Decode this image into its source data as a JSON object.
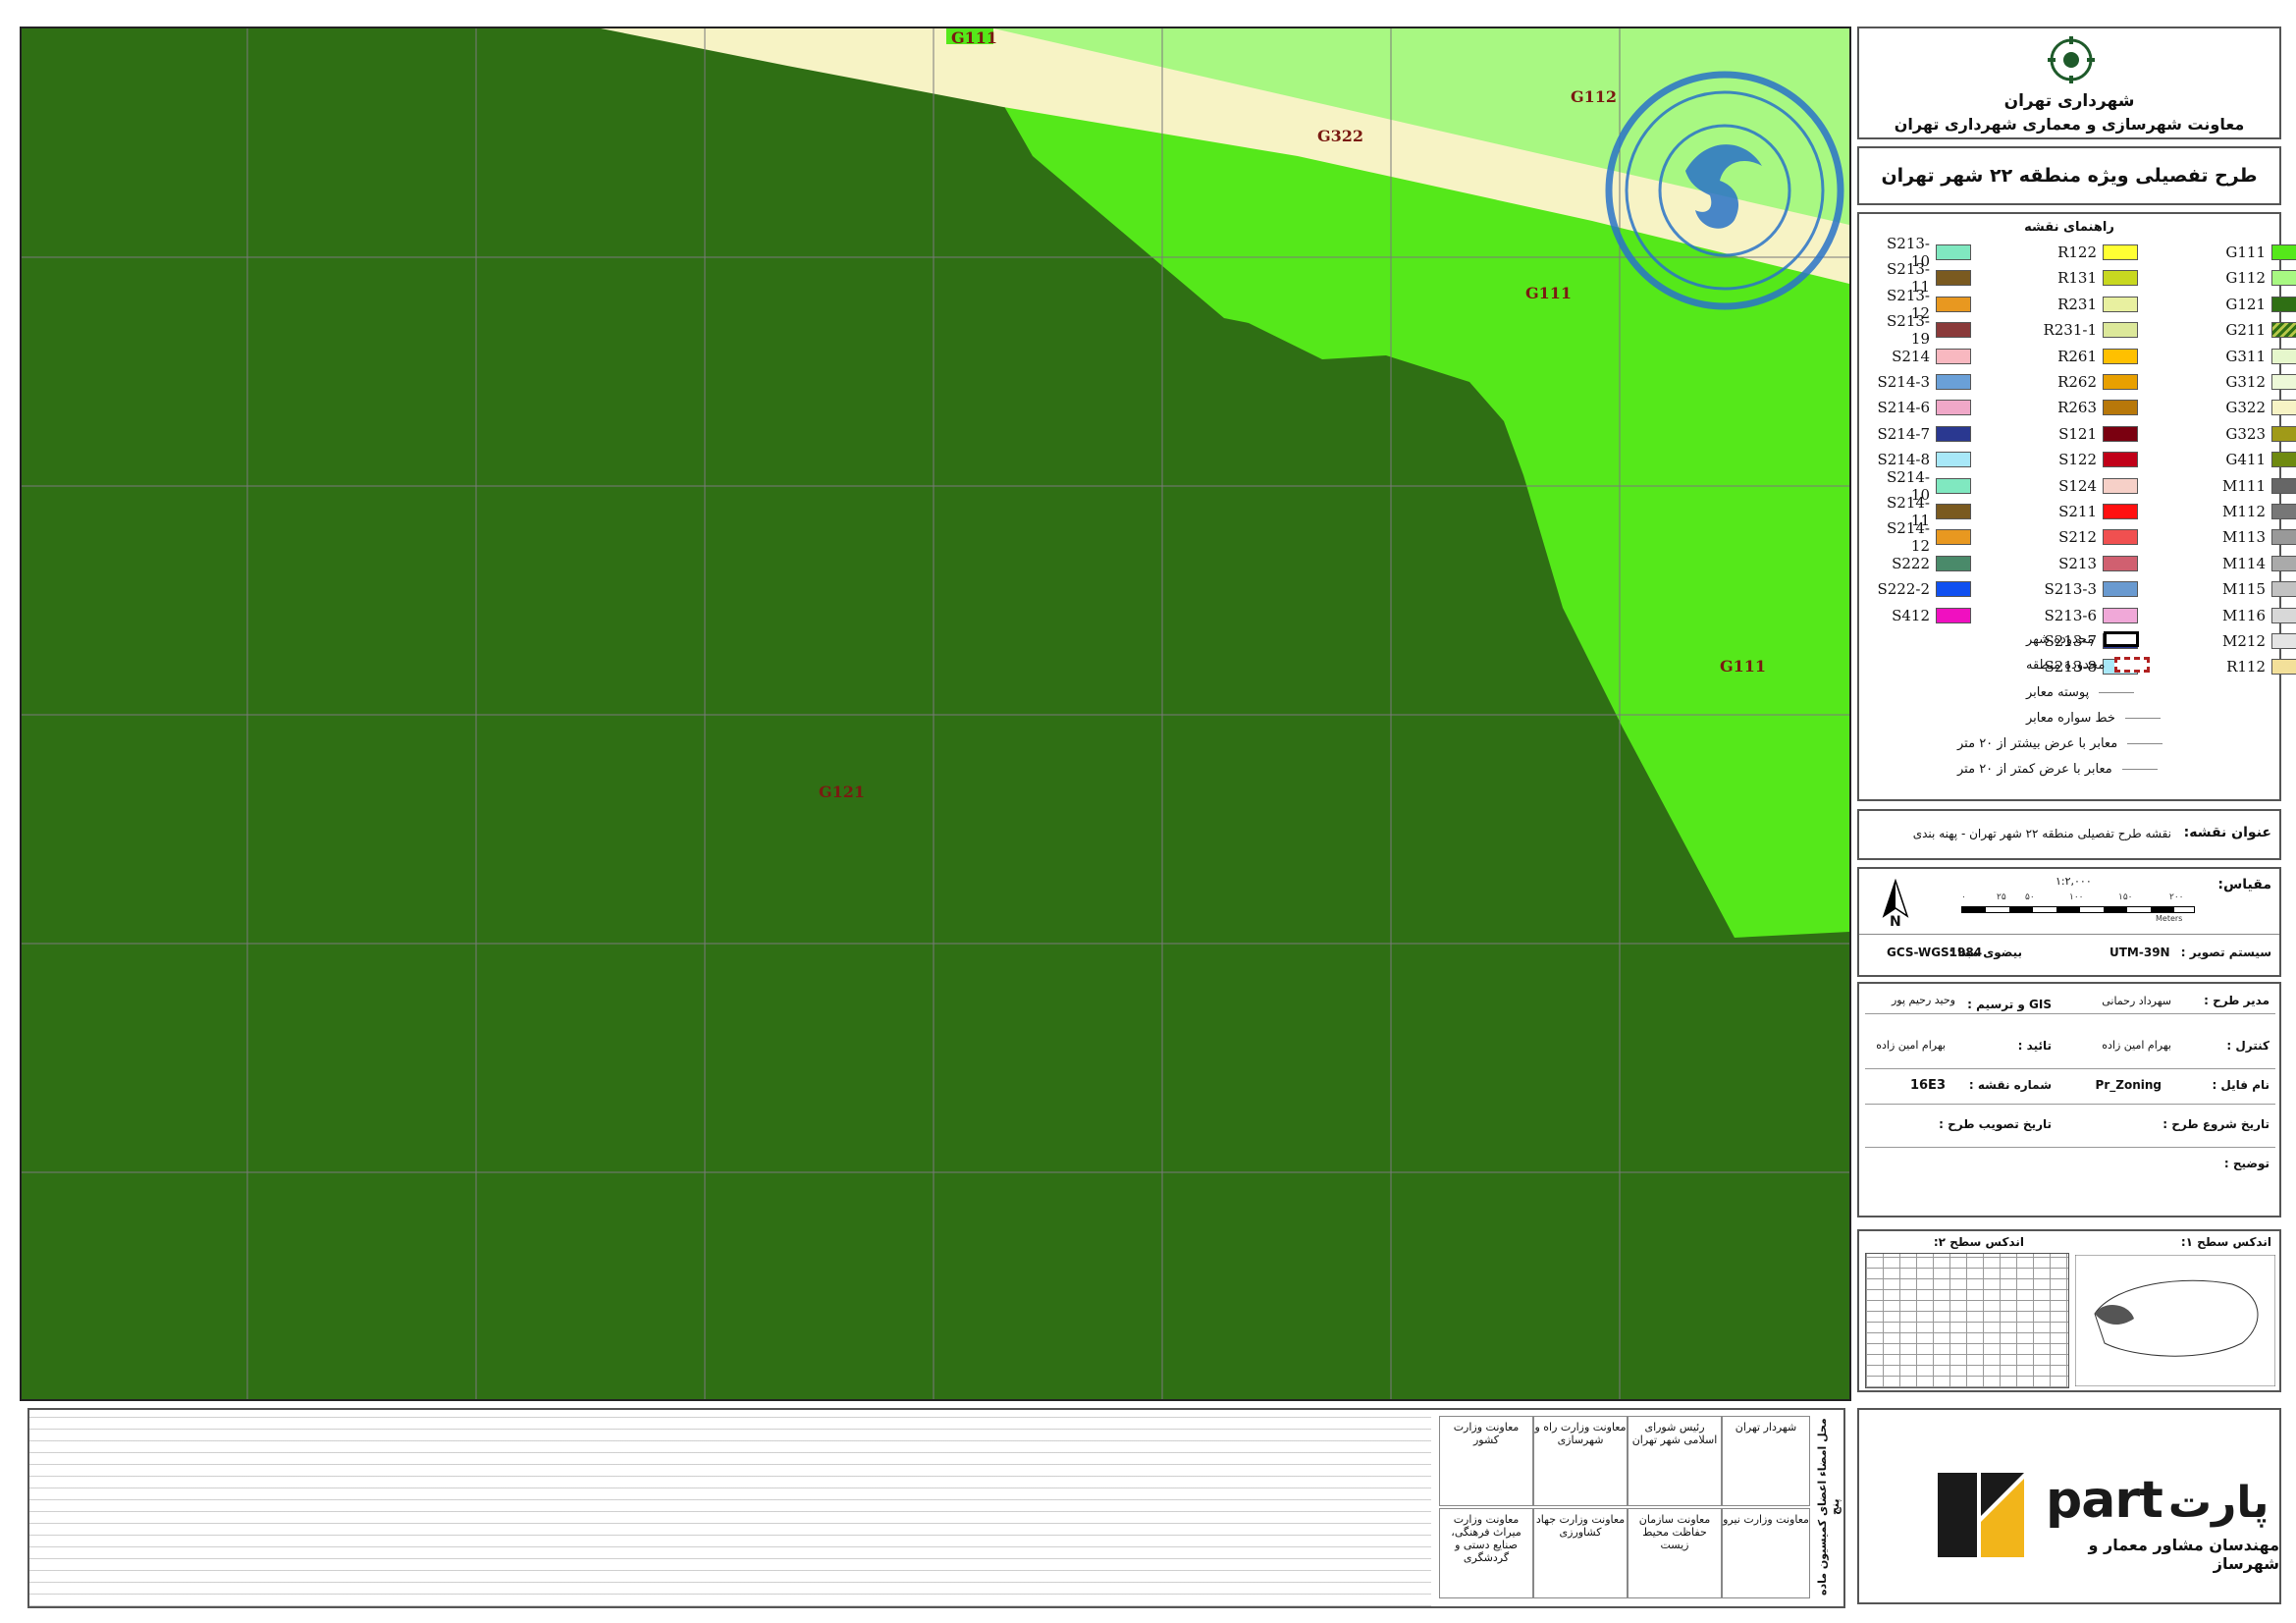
{
  "header": {
    "org_name": "شهرداری تهران",
    "org_sub": "معاونت شهرسازی و معماری شهرداری تهران",
    "plan_title": "طرح تفصیلی ویژه منطقه ۲۲ شهر تهران"
  },
  "stamp": {
    "text": "معاونت شورای اسلامی شهر تهران"
  },
  "map": {
    "zone_labels": [
      {
        "id": "g111-top",
        "text": "G111"
      },
      {
        "id": "g112",
        "text": "G112"
      },
      {
        "id": "g322",
        "text": "G322"
      },
      {
        "id": "g111-mid",
        "text": "G111"
      },
      {
        "id": "g111-right",
        "text": "G111"
      },
      {
        "id": "g121",
        "text": "G121"
      }
    ],
    "colors": {
      "G121": "#2f6f14",
      "G111": "#55e81a",
      "G112": "#a8f882",
      "G322": "#f7f3c5"
    }
  },
  "legend": {
    "title": "راهنمای نقشه",
    "col1": [
      {
        "code": "G111",
        "color": "#55e81a"
      },
      {
        "code": "G112",
        "color": "#a8f882"
      },
      {
        "code": "G121",
        "color": "#2f6f14"
      },
      {
        "code": "G211",
        "color": "#b8c84a"
      },
      {
        "code": "G311",
        "color": "#e6f7cc"
      },
      {
        "code": "G312",
        "color": "#edf8d8"
      },
      {
        "code": "G322",
        "color": "#f7f3c5"
      },
      {
        "code": "G323",
        "color": "#a09a18"
      },
      {
        "code": "G411",
        "color": "#6f8a10"
      },
      {
        "code": "M111",
        "color": "#666666"
      },
      {
        "code": "M112",
        "color": "#777777"
      },
      {
        "code": "M113",
        "color": "#999999"
      },
      {
        "code": "M114",
        "color": "#aaaaaa"
      },
      {
        "code": "M115",
        "color": "#c2c2c2"
      },
      {
        "code": "M116",
        "color": "#d8d8d8"
      },
      {
        "code": "M212",
        "color": "#e4e4e4"
      },
      {
        "code": "R112",
        "color": "#f3e09a"
      }
    ],
    "col2": [
      {
        "code": "R122",
        "color": "#ffff33"
      },
      {
        "code": "R131",
        "color": "#c8d820"
      },
      {
        "code": "R231",
        "color": "#e8f0a0"
      },
      {
        "code": "R231-1",
        "color": "#dce89a"
      },
      {
        "code": "R261",
        "color": "#ffc000"
      },
      {
        "code": "R262",
        "color": "#e8a000"
      },
      {
        "code": "R263",
        "color": "#b8780a"
      },
      {
        "code": "S121",
        "color": "#7a0010"
      },
      {
        "code": "S122",
        "color": "#c00018"
      },
      {
        "code": "S124",
        "color": "#f6d0c8"
      },
      {
        "code": "S211",
        "color": "#ff1010"
      },
      {
        "code": "S212",
        "color": "#f05050"
      },
      {
        "code": "S213",
        "color": "#d06070"
      },
      {
        "code": "S213-3",
        "color": "#6a9ad0"
      },
      {
        "code": "S213-6",
        "color": "#f0a8d8"
      },
      {
        "code": "S213-7",
        "color": "#2a3a9a"
      },
      {
        "code": "S213-8",
        "color": "#a8e8f8"
      }
    ],
    "col3": [
      {
        "code": "S213-10",
        "color": "#80e8c0"
      },
      {
        "code": "S213-11",
        "color": "#7a5a20"
      },
      {
        "code": "S213-12",
        "color": "#e89820"
      },
      {
        "code": "S213-19",
        "color": "#8a3a3a"
      },
      {
        "code": "S214",
        "color": "#f8b8c0"
      },
      {
        "code": "S214-3",
        "color": "#6aa0d8"
      },
      {
        "code": "S214-6",
        "color": "#f0a8c8"
      },
      {
        "code": "S214-7",
        "color": "#2a3890"
      },
      {
        "code": "S214-8",
        "color": "#a8e8f8"
      },
      {
        "code": "S214-10",
        "color": "#80e8c0"
      },
      {
        "code": "S214-11",
        "color": "#7a5a20"
      },
      {
        "code": "S214-12",
        "color": "#e89820"
      },
      {
        "code": "S222",
        "color": "#4a8a6a"
      },
      {
        "code": "S222-2",
        "color": "#1050f0"
      },
      {
        "code": "S412",
        "color": "#f010c0"
      }
    ],
    "boundaries": [
      "محدوده شهر",
      "محدوده منطقه"
    ],
    "lines": [
      "پوسته معابر",
      "خط سواره معابر",
      "معابر با عرض بیشتر از ۲۰ متر",
      "معابر با عرض کمتر از ۲۰ متر"
    ]
  },
  "map_title": {
    "label": "عنوان نقشه:",
    "value": "نقشه طرح تفصیلی منطقه ۲۲ شهر تهران - پهنه بندی"
  },
  "scale": {
    "label": "مقیاس:",
    "ratio": "۱:۲,۰۰۰",
    "ticks": [
      "۲۰۰",
      "۱۵۰",
      "۱۰۰",
      "۵۰",
      "۲۵",
      "۰"
    ],
    "unit": "Meters",
    "north": "N",
    "projection_label": "سیستم تصویر :",
    "projection": "UTM-39N",
    "datum_label": "بیضوی مبنا :",
    "datum": "GCS-WGS1984"
  },
  "staff": {
    "manager_label": "مدیر طرح :",
    "manager": "سهرداد رحمانی",
    "gis_label": "GIS و ترسیم :",
    "gis": "وحید رحیم پور",
    "control_label": "کنترل :",
    "control": "بهرام امین زاده",
    "approve_label": "تائید :",
    "approve": "بهرام امین زاده",
    "file_label": "نام فایل :",
    "file": "Pr_Zoning",
    "sheet_label": "شماره نقشه :",
    "sheet": "16E3",
    "start_label": "تاریخ شروع طرح :",
    "approval_label": "تاریخ تصویب طرح :",
    "notes_label": "توضیح :"
  },
  "index": {
    "level1": "اندکس سطح ۱:",
    "level2": "اندکس سطح ۲:"
  },
  "signatures": [
    "شهردار تهران",
    "رئیس شورای اسلامی شهر تهران",
    "معاونت وزارت راه و شهرسازی",
    "معاونت وزارت کشور",
    "معاونت وزارت نیرو",
    "معاونت سازمان حفاظت محیط زیست",
    "معاونت وزارت جهاد کشاورزی",
    "معاونت وزارت میراث فرهنگی، صنایع دستی و گردشگری"
  ],
  "bottom": {
    "side_title": "محل امضاء اعضای کمیسیون ماده پنج"
  },
  "part": {
    "brand": "part",
    "brand_fa": "پارت",
    "sub": "مهندسان مشاور معمار و شهرساز"
  }
}
